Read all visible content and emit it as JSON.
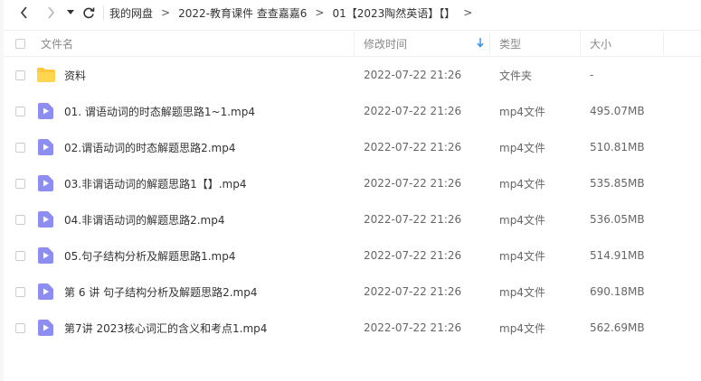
{
  "nav": {
    "breadcrumbs": [
      "我的网盘",
      "2022-教育课件 查查嘉嘉6",
      "01【2023陶然英语】【】"
    ],
    "trailing_arrow": ">"
  },
  "header": {
    "name": "文件名",
    "modified": "修改时间",
    "type": "类型",
    "size": "大小",
    "sort_icon": "arrow-down-icon"
  },
  "colors": {
    "folder": "#ffc83d",
    "video": "#8d8df2",
    "sort_accent": "#2d8cf0"
  },
  "files": [
    {
      "name": "资料",
      "modified": "2022-07-22 21:26",
      "type": "文件夹",
      "size": "-",
      "icon": "folder-icon"
    },
    {
      "name": "01. 谓语动词的时态解题思路1~1.mp4",
      "modified": "2022-07-22 21:26",
      "type": "mp4文件",
      "size": "495.07MB",
      "icon": "video-file-icon"
    },
    {
      "name": "02.谓语动词的时态解题思路2.mp4",
      "modified": "2022-07-22 21:26",
      "type": "mp4文件",
      "size": "510.81MB",
      "icon": "video-file-icon"
    },
    {
      "name": "03.非谓语动词的解题思路1【】.mp4",
      "modified": "2022-07-22 21:26",
      "type": "mp4文件",
      "size": "535.85MB",
      "icon": "video-file-icon"
    },
    {
      "name": "04.非谓语动词的解题思路2.mp4",
      "modified": "2022-07-22 21:26",
      "type": "mp4文件",
      "size": "536.05MB",
      "icon": "video-file-icon"
    },
    {
      "name": "05.句子结构分析及解题思路1.mp4",
      "modified": "2022-07-22 21:26",
      "type": "mp4文件",
      "size": "514.91MB",
      "icon": "video-file-icon"
    },
    {
      "name": "第 6 讲 句子结构分析及解题思路2.mp4",
      "modified": "2022-07-22 21:26",
      "type": "mp4文件",
      "size": "690.18MB",
      "icon": "video-file-icon"
    },
    {
      "name": "第7讲 2023核心词汇的含义和考点1.mp4",
      "modified": "2022-07-22 21:26",
      "type": "mp4文件",
      "size": "562.69MB",
      "icon": "video-file-icon"
    }
  ]
}
